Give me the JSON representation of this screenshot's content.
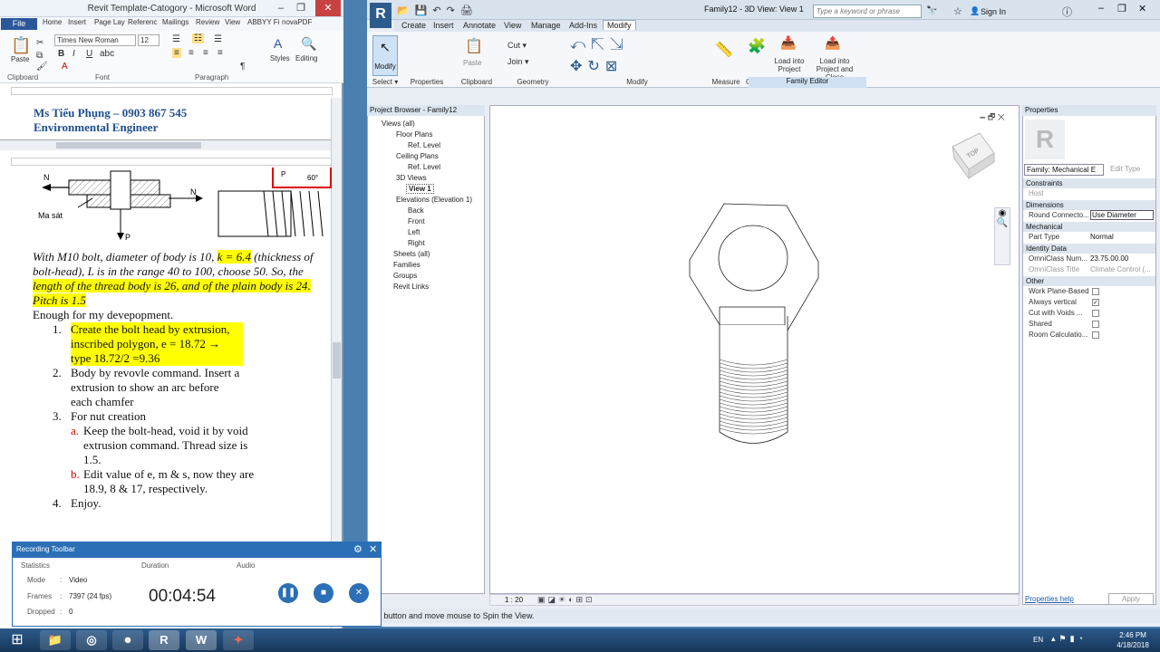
{
  "word": {
    "title": "Revit Template-Catogory - Microsoft Word",
    "file_tab": "File",
    "tabs": [
      "Home",
      "Insert",
      "Page Lay",
      "Referenc",
      "Mailings",
      "Review",
      "View",
      "ABBYY Fi",
      "novaPDF"
    ],
    "font": "Times New Roman",
    "size": "12",
    "groups": {
      "clipboard": "Clipboard",
      "font": "Font",
      "paragraph": "Paragraph"
    },
    "buttons": {
      "paste": "Paste",
      "styles": "Styles",
      "editing": "Editing"
    },
    "header1": "Ms Tiểu Phụng – 0903 867 545",
    "header2": "Environmental Engineer",
    "fig": {
      "n1": "N",
      "n2": "N",
      "p1": "P",
      "p2": "P",
      "angle": "60°",
      "masat": "Ma sát"
    },
    "p1a": "With M10 bolt, diameter of body is 10, ",
    "p1b": "k = 6.4",
    "p1c": " (thickness of bolt-head), L is in the range 40 to 100, choose 50. So, the ",
    "p1d": "length of the thread body is 26, and of the plain body is 24. Pitch is 1.5",
    "p2": "Enough for my devepopment.",
    "items": [
      {
        "n": "1.",
        "t": "Create the bolt head by extrusion, inscribed polygon, e = 18.72 → type 18.72/2 =9.36"
      },
      {
        "n": "2.",
        "t": "Body by revovle command. Insert a extrusion to show an arc before each chamfer"
      },
      {
        "n": "3.",
        "t": "For nut creation"
      },
      {
        "n": "4.",
        "t": "Enjoy."
      }
    ],
    "sub": [
      {
        "n": "a.",
        "t": "Keep the bolt-head, void it by void extrusion command. Thread size is 1.5."
      },
      {
        "n": "b.",
        "t": "Edit value of e, m & s, now they are 18.9, 8 & 17, respectively."
      }
    ]
  },
  "revit": {
    "title": "Family12 - 3D View: View 1",
    "search_placeholder": "Type a keyword or phrase",
    "sign_in": "Sign In",
    "logo": "R",
    "tabs": [
      "Create",
      "Insert",
      "Annotate",
      "View",
      "Manage",
      "Add-Ins",
      "Modify"
    ],
    "groups": [
      "Select ▾",
      "Properties",
      "Clipboard",
      "Geometry",
      "Modify",
      "Measure",
      "Create",
      "Family Editor"
    ],
    "modify_label": "Modify",
    "paste": "Paste",
    "cut": "Cut ▾",
    "join": "Join ▾",
    "load_into_project": "Load into Project",
    "load_close": "Load into Project and Close",
    "project_browser_title": "Project Browser - Family12",
    "browser": [
      "Views (all)",
      "Floor Plans",
      "Ref. Level",
      "Ceiling Plans",
      "Ref. Level",
      "3D Views",
      "View 1",
      "Elevations (Elevation 1)",
      "Back",
      "Front",
      "Left",
      "Right",
      "Sheets (all)",
      "Families",
      "Groups",
      "Revit Links"
    ],
    "scale": "1 : 20",
    "viewcube": "TOP",
    "properties_title": "Properties",
    "family_selector": "Family: Mechanical E",
    "edit_type": "Edit Type",
    "sections": [
      "Constraints",
      "Dimensions",
      "Mechanical",
      "Identity Data",
      "Other"
    ],
    "rows": [
      {
        "l": "Host",
        "v": ""
      },
      {
        "l": "Round Connecto...",
        "v": "Use Diameter"
      },
      {
        "l": "Part Type",
        "v": "Normal"
      },
      {
        "l": "OmniClass Num...",
        "v": "23.75.00.00"
      },
      {
        "l": "OmniClass Title",
        "v": "Climate Control (..."
      },
      {
        "l": "Work Plane-Based",
        "v": ""
      },
      {
        "l": "Always vertical",
        "v": "✓"
      },
      {
        "l": "Cut with Voids ...",
        "v": ""
      },
      {
        "l": "Shared",
        "v": ""
      },
      {
        "l": "Room Calculatio...",
        "v": ""
      }
    ],
    "properties_help": "Properties help",
    "apply": "Apply",
    "status": "l button and move mouse to Spin the View."
  },
  "recorder": {
    "title": "Recording Toolbar",
    "statistics": "Statistics",
    "duration": "Duration",
    "audio": "Audio",
    "mode_label": "Mode",
    "mode": "Video",
    "frames_label": "Frames",
    "frames": "7397 (24 fps)",
    "dropped_label": "Dropped",
    "dropped": "0",
    "time": "00:04:54"
  },
  "taskbar": {
    "lang": "EN",
    "time": "2:46 PM",
    "date": "4/18/2018"
  }
}
